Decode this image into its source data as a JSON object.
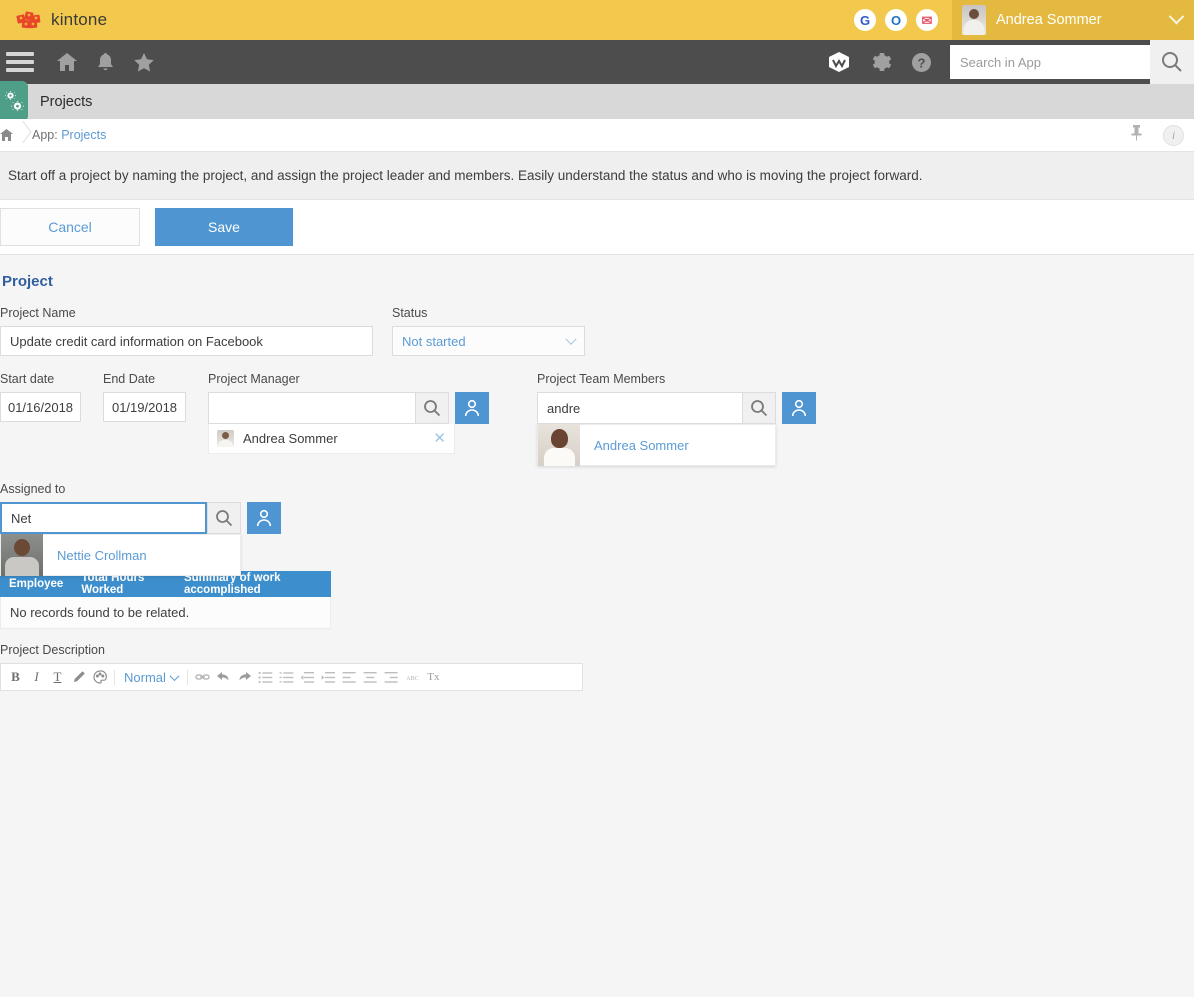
{
  "brand": {
    "name": "kintone",
    "logo_icon": "kintone-blocks-logo",
    "bar_color": "#f2c94c"
  },
  "topbar": {
    "services": [
      {
        "id": "google",
        "icon": "google-icon",
        "glyph": "G"
      },
      {
        "id": "office",
        "icon": "office-icon",
        "glyph": "O"
      },
      {
        "id": "mail",
        "icon": "mail-icon",
        "glyph": "✉"
      }
    ],
    "user_name": "Andrea Sommer",
    "user_avatar_icon": "user-avatar",
    "caret_icon": "chevron-down-icon"
  },
  "navbar": {
    "menu_icon": "hamburger-menu-icon",
    "items": [
      {
        "id": "home",
        "icon": "home-icon"
      },
      {
        "id": "notifications",
        "icon": "bell-icon"
      },
      {
        "id": "favorites",
        "icon": "star-icon"
      }
    ],
    "right_items": [
      {
        "id": "apps",
        "icon": "kintone-cube-icon"
      },
      {
        "id": "settings",
        "icon": "gear-icon"
      },
      {
        "id": "help",
        "icon": "question-mark-icon"
      }
    ],
    "search": {
      "placeholder": "Search in App",
      "value": "",
      "button_icon": "search-icon"
    }
  },
  "appbar": {
    "app_icon": "gears-app-icon",
    "app_icon_color": "#4f9e88",
    "title": "Projects"
  },
  "breadcrumb": {
    "home_icon": "home-icon",
    "prefix": "App:",
    "app_link": "Projects",
    "pin_icon": "pin-icon",
    "info_icon": "info-icon"
  },
  "description": {
    "text": "Start off a project by naming the project, and assign the project leader and members. Easily understand the status and who is moving the project forward."
  },
  "actions": {
    "cancel_label": "Cancel",
    "save_label": "Save",
    "save_color": "#4e95d2"
  },
  "form": {
    "section_title": "Project",
    "project_name": {
      "label": "Project Name",
      "value": "Update credit card information on Facebook"
    },
    "status": {
      "label": "Status",
      "value": "Not started",
      "caret_icon": "chevron-down-icon"
    },
    "start_date": {
      "label": "Start date",
      "value": "01/16/2018"
    },
    "end_date": {
      "label": "End Date",
      "value": "01/19/2018"
    },
    "project_manager": {
      "label": "Project Manager",
      "value": "",
      "search_icon": "search-icon",
      "person_icon": "person-picker-icon",
      "selected": {
        "name": "Andrea Sommer",
        "remove_icon": "close-icon"
      }
    },
    "team_members": {
      "label": "Project Team Members",
      "value": "andre",
      "search_icon": "search-icon",
      "person_icon": "person-picker-icon",
      "suggestion": {
        "name": "Andrea Sommer"
      }
    },
    "assigned_to": {
      "label": "Assigned to",
      "value": "Net",
      "focused": true,
      "search_icon": "search-icon",
      "person_icon": "person-picker-icon",
      "suggestion": {
        "name": "Nettie Crollman"
      }
    },
    "related_records": {
      "columns": [
        "Employee",
        "Total Hours Worked",
        "Summary of work accomplished"
      ],
      "empty_message": "No records found to be related.",
      "header_color": "#3d8ecc"
    },
    "project_description": {
      "label": "Project Description",
      "style_value": "Normal",
      "toolbar": [
        {
          "id": "bold",
          "icon": "bold-icon",
          "glyph": "B"
        },
        {
          "id": "italic",
          "icon": "italic-icon",
          "glyph": "I"
        },
        {
          "id": "underline",
          "icon": "text-underline-icon",
          "glyph": "T"
        },
        {
          "id": "highlight",
          "icon": "pen-highlight-icon",
          "glyph": "✎"
        },
        {
          "id": "text-color",
          "icon": "color-palette-icon",
          "glyph": "◔"
        },
        {
          "id": "link",
          "icon": "link-icon",
          "glyph": "⚭"
        },
        {
          "id": "undo",
          "icon": "undo-arrow-icon",
          "glyph": "↶"
        },
        {
          "id": "redo",
          "icon": "redo-arrow-icon",
          "glyph": "↷"
        },
        {
          "id": "bullet-list",
          "icon": "bullet-list-icon",
          "glyph": "≣"
        },
        {
          "id": "numbered-list",
          "icon": "numbered-list-icon",
          "glyph": "≣"
        },
        {
          "id": "outdent",
          "icon": "outdent-icon",
          "glyph": "≣"
        },
        {
          "id": "indent",
          "icon": "indent-icon",
          "glyph": "≣"
        },
        {
          "id": "align-left",
          "icon": "align-left-icon",
          "glyph": "≡"
        },
        {
          "id": "align-center",
          "icon": "align-center-icon",
          "glyph": "≡"
        },
        {
          "id": "align-right",
          "icon": "align-right-icon",
          "glyph": "≡"
        },
        {
          "id": "spellcheck",
          "icon": "spellcheck-abc-icon",
          "glyph": "abc"
        },
        {
          "id": "clear-format",
          "icon": "clear-formatting-icon",
          "glyph": "Tx"
        }
      ]
    }
  }
}
